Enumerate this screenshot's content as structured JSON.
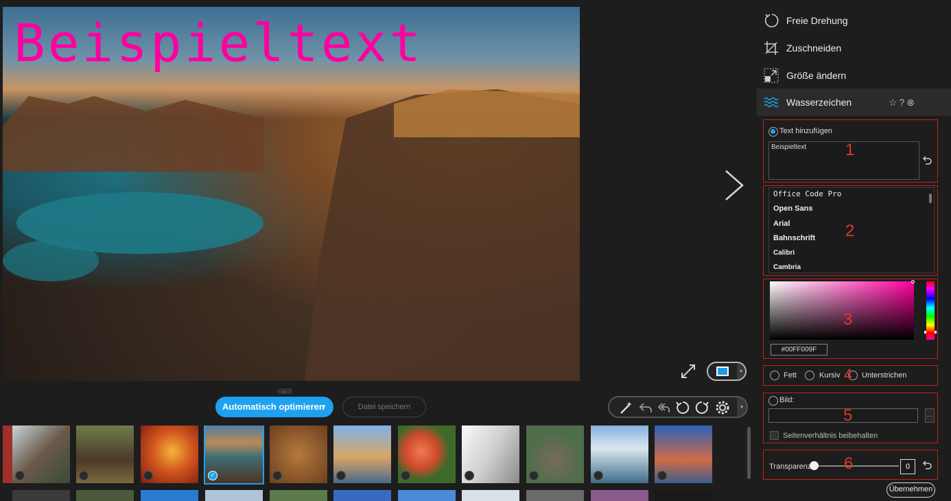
{
  "preview": {
    "watermark_text": "Beispieltext",
    "watermark_color": "#ff009f"
  },
  "toolbar": {
    "auto_optimize_label": "Automatisch optimieren",
    "save_file_label": "Datei speichern",
    "accent_color": "#1ea1f0"
  },
  "thumbnails": {
    "selected_index": 3,
    "count_visible_row": 11
  },
  "panel": {
    "menu": [
      {
        "label": "Freie Drehung",
        "icon": "rotate-icon"
      },
      {
        "label": "Zuschneiden",
        "icon": "crop-icon"
      },
      {
        "label": "Größe ändern",
        "icon": "resize-icon"
      },
      {
        "label": "Wasserzeichen",
        "icon": "watermark-icon"
      }
    ],
    "text_section": {
      "radio_label": "Text hinzufügen",
      "text_value": "Beispieltext",
      "number": "1"
    },
    "font_section": {
      "fonts": [
        "Office Code Pro",
        "Open Sans",
        "Arial",
        "Bahnschrift",
        "Calibri",
        "Cambria"
      ],
      "number": "2"
    },
    "color_section": {
      "hex_value": "#00FF009F",
      "number": "3"
    },
    "style_section": {
      "bold_label": "Fett",
      "italic_label": "Kursiv",
      "underline_label": "Unterstrichen",
      "number": "4"
    },
    "image_section": {
      "radio_label": "Bild:",
      "aspect_label": "Seitenverhältnis beibehalten",
      "number": "5"
    },
    "opacity_section": {
      "label": "Transparenz",
      "value": "0",
      "number": "6"
    },
    "apply_label": "Übernehmen",
    "annotation_color": "#c0211b"
  }
}
